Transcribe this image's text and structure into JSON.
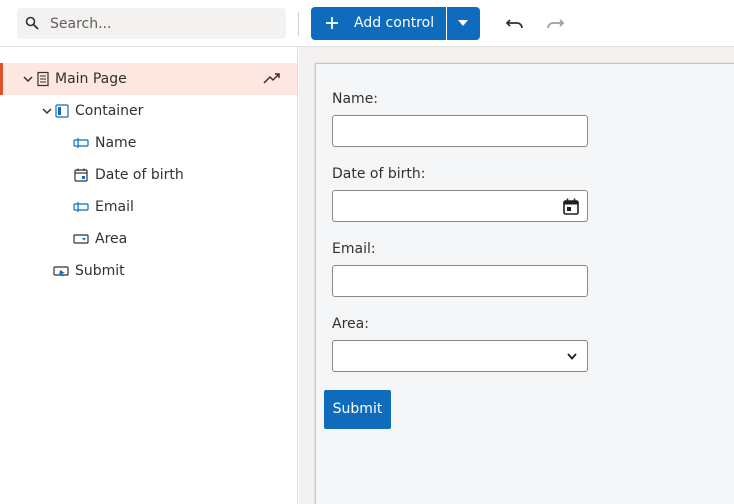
{
  "toolbar": {
    "search_placeholder": "Search...",
    "add_control_label": "Add control"
  },
  "tree": {
    "items": [
      {
        "label": "Main Page",
        "icon": "page-icon",
        "level": 0,
        "expanded": true,
        "selected": true
      },
      {
        "label": "Container",
        "icon": "container-icon",
        "level": 1,
        "expanded": true
      },
      {
        "label": "Name",
        "icon": "text-input-icon",
        "level": 2
      },
      {
        "label": "Date of birth",
        "icon": "calendar-icon",
        "level": 2
      },
      {
        "label": "Email",
        "icon": "text-input-icon",
        "level": 2
      },
      {
        "label": "Area",
        "icon": "dropdown-icon",
        "level": 2
      },
      {
        "label": "Submit",
        "icon": "button-icon",
        "level": 1
      }
    ]
  },
  "form": {
    "name_label": "Name:",
    "dob_label": "Date of birth:",
    "email_label": "Email:",
    "area_label": "Area:",
    "submit_label": "Submit"
  },
  "colors": {
    "accent": "#0f6cbd",
    "selection_bg": "#fde7e0",
    "selection_bar": "#d9542c"
  }
}
